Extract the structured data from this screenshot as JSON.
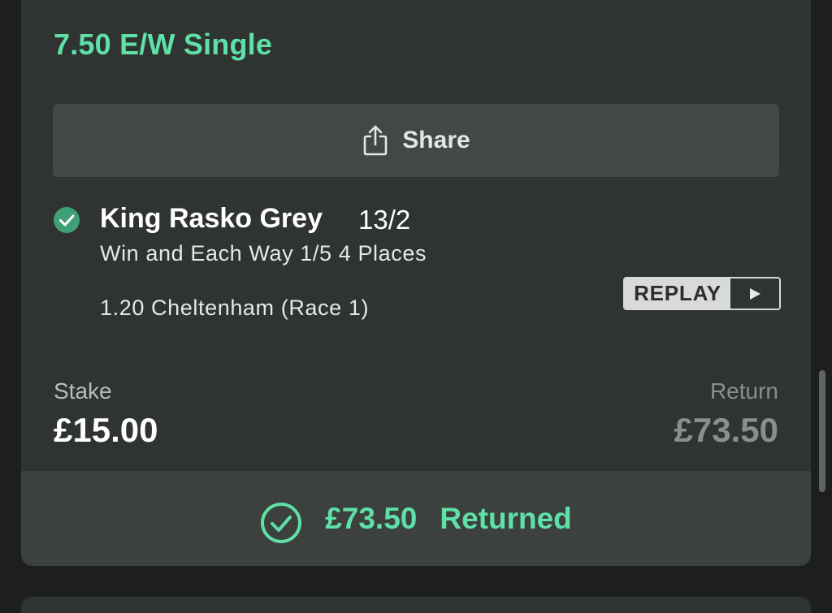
{
  "bet": {
    "title": "7.50 E/W Single",
    "share_label": "Share",
    "selection": {
      "name": "King Rasko Grey",
      "odds": "13/2",
      "market": "Win and Each Way 1/5 4 Places",
      "event": "1.20 Cheltenham (Race 1)",
      "status": "won"
    },
    "replay_label": "REPLAY",
    "stake_label": "Stake",
    "stake_value": "£15.00",
    "return_label": "Return",
    "return_value": "£73.50",
    "returned_amount": "£73.50",
    "returned_text": "Returned"
  },
  "colors": {
    "accent_green": "#5ee0a6",
    "check_green": "#3fa077",
    "card_bg": "#2f3331",
    "button_bg": "#434745",
    "returned_bg": "#3c403e"
  },
  "icons": {
    "share": "share-icon",
    "selection_status": "check-circle-icon",
    "replay": "play-icon",
    "returned": "check-circle-outline-icon"
  }
}
